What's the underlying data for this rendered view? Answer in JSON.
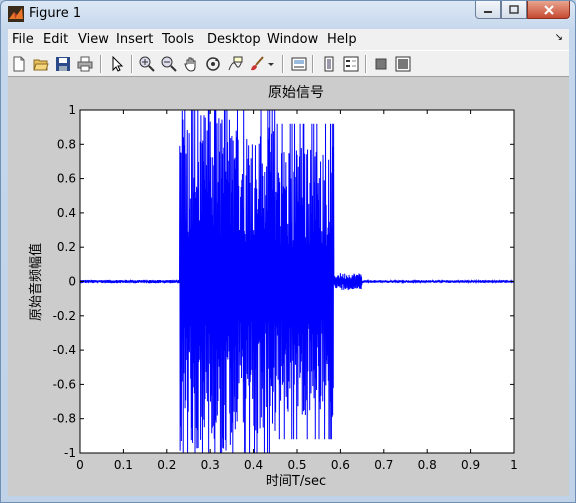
{
  "window": {
    "title": "Figure 1"
  },
  "menu": [
    "File",
    "Edit",
    "View",
    "Insert",
    "Tools",
    "Desktop",
    "Window",
    "Help"
  ],
  "menu_overflow_icon": "dock-arrow-icon",
  "toolbar": [
    "new-figure-icon",
    "open-file-icon",
    "save-figure-icon",
    "print-figure-icon",
    "edit-plot-arrow-icon",
    "zoom-in-icon",
    "zoom-out-icon",
    "pan-hand-icon",
    "rotate-3d-icon",
    "data-cursor-icon",
    "brush-icon",
    "link-plot-icon",
    "insert-colorbar-icon",
    "insert-legend-icon",
    "hide-plot-tools-icon",
    "show-plot-tools-icon"
  ],
  "colors": {
    "signal": "#0000ff",
    "axes_bg": "#ffffff",
    "figure_bg": "#cccccc"
  },
  "chart_data": {
    "type": "line",
    "title": "原始信号",
    "xlabel": "时间T/sec",
    "ylabel": "原始音频幅值",
    "xlim": [
      0,
      1
    ],
    "ylim": [
      -1,
      1
    ],
    "xticks": [
      "0",
      "0.1",
      "0.2",
      "0.3",
      "0.4",
      "0.5",
      "0.6",
      "0.7",
      "0.8",
      "0.9",
      "1"
    ],
    "yticks": [
      "-1",
      "-0.8",
      "-0.6",
      "-0.4",
      "-0.2",
      "0",
      "0.2",
      "0.4",
      "0.6",
      "0.8",
      "1"
    ],
    "grid": false,
    "series": [
      {
        "segments": [
          {
            "x_start": 0.0,
            "x_end": 0.23,
            "approx_amplitude": 0.01
          },
          {
            "x_start": 0.23,
            "x_end": 0.26,
            "approx_amplitude": 1.0
          },
          {
            "x_start": 0.26,
            "x_end": 0.35,
            "approx_amplitude": 1.0
          },
          {
            "x_start": 0.35,
            "x_end": 0.45,
            "approx_amplitude": 0.9
          },
          {
            "x_start": 0.45,
            "x_end": 0.585,
            "approx_amplitude": 0.8
          },
          {
            "x_start": 0.585,
            "x_end": 0.65,
            "approx_amplitude": 0.05
          },
          {
            "x_start": 0.65,
            "x_end": 1.0,
            "approx_amplitude": 0.008
          }
        ]
      }
    ]
  }
}
